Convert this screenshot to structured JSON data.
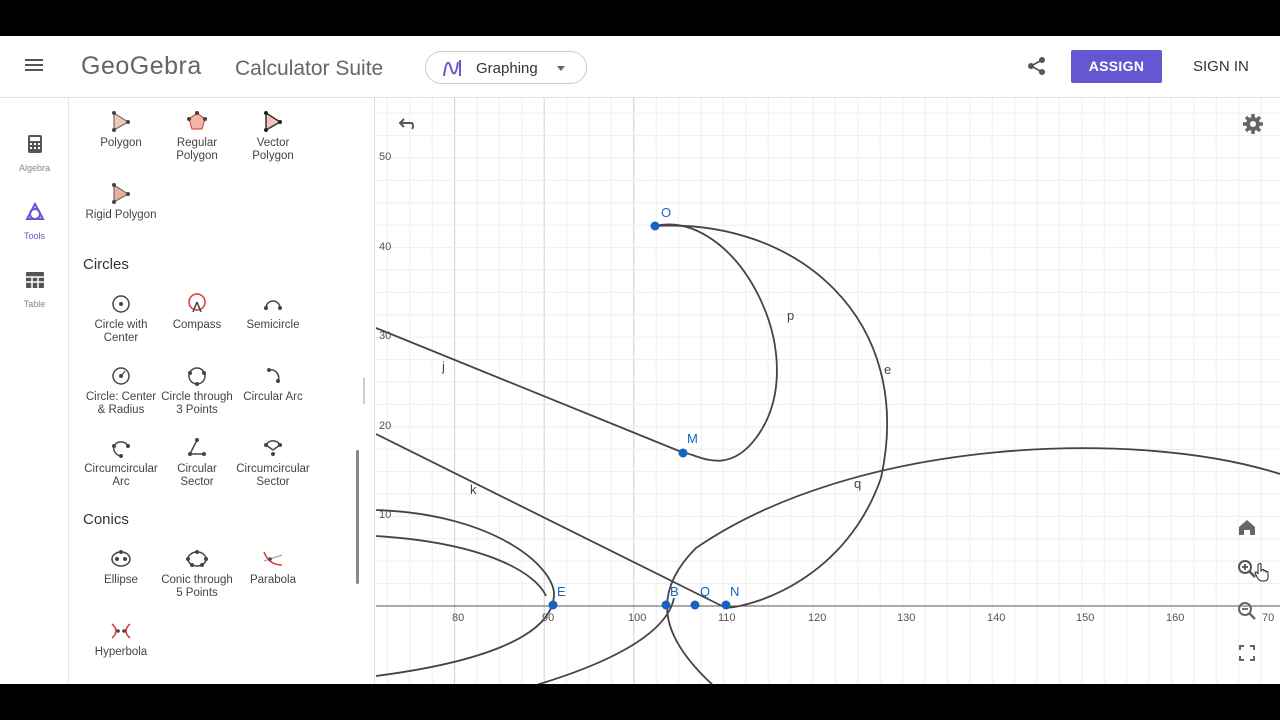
{
  "header": {
    "logo": "GeoGebra",
    "suite": "Calculator Suite",
    "app_selector": "Graphing",
    "assign": "ASSIGN",
    "sign_in": "SIGN IN"
  },
  "rail": {
    "items": [
      {
        "label": "Algebra",
        "icon": "calculator-icon"
      },
      {
        "label": "Tools",
        "icon": "shapes-icon",
        "active": true
      },
      {
        "label": "Table",
        "icon": "table-icon"
      }
    ]
  },
  "tools": {
    "polygons": [
      "Polygon",
      "Regular Polygon",
      "Vector Polygon",
      "Rigid Polygon"
    ],
    "circles_title": "Circles",
    "circles": [
      "Circle with Center",
      "Compass",
      "Semicircle",
      "Circle: Center & Radius",
      "Circle through 3 Points",
      "Circular Arc",
      "Circumcircular Arc",
      "Circular Sector",
      "Circumcircular Sector"
    ],
    "conics_title": "Conics",
    "conics": [
      "Ellipse",
      "Conic through 5 Points",
      "Parabola",
      "Hyperbola"
    ]
  },
  "graph": {
    "x_ticks": [
      "80",
      "90",
      "100",
      "110",
      "120",
      "130",
      "140",
      "150",
      "160",
      "70"
    ],
    "y_ticks": [
      "50",
      "40",
      "30",
      "20",
      "10"
    ],
    "point_labels": [
      "O",
      "M",
      "E",
      "B",
      "Q",
      "N"
    ],
    "curve_labels": [
      "p",
      "e",
      "j",
      "k",
      "q"
    ],
    "accent_color": "#1565c0",
    "curve_color": "#444444"
  },
  "colors": {
    "brand": "#6557d2",
    "point": "#1565c0"
  }
}
